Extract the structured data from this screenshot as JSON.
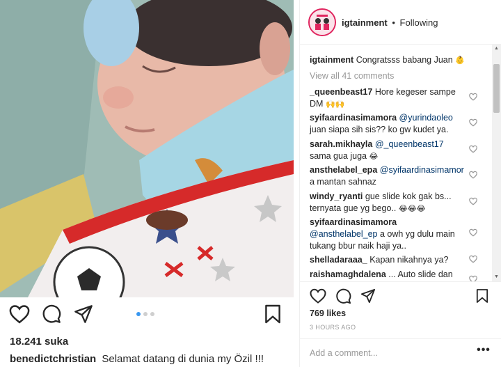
{
  "post": {
    "left_likes": "18.241 suka",
    "left_caption_user": "benedictchristian",
    "left_caption_text": "Selamat datang di dunia my Özil !!!",
    "carousel": {
      "count": 3,
      "active": 0
    }
  },
  "panel": {
    "header": {
      "username": "igtainment",
      "separator": "•",
      "follow_label": "Following"
    },
    "caption": {
      "user": "igtainment",
      "text": "Congratsss babang Juan",
      "emoji": "👶"
    },
    "view_all_label": "View all 41 comments",
    "comments": [
      {
        "user": "_queenbeast17",
        "text": "Hore kegeser sampe DM",
        "emoji": "🙌🙌"
      },
      {
        "user": "syifaardinasimamora",
        "mention": "@yurindaoleo",
        "text": "juan siapa sih sis?? ko gw kudet ya."
      },
      {
        "user": "sarah.mikhayla",
        "mention": "@_queenbeast17",
        "text": "sama gua juga",
        "emoji": "😂"
      },
      {
        "user": "ansthelabel_epa",
        "mention": "@syifaardinasimamor",
        "text": "a mantan sahnaz"
      },
      {
        "user": "windy_ryanti",
        "text": "gue slide kok gak bs... ternyata gue yg bego..",
        "emoji": "😂😂😂"
      },
      {
        "user": "syifaardinasimamora",
        "mention": "@ansthelabel_ep",
        "text": "a owh yg dulu main tukang bbur naik haji ya.."
      },
      {
        "user": "shelladaraaa_",
        "text": "Kapan nikahnya ya?"
      },
      {
        "user": "raishamaghdalena",
        "text": "... Auto slide dan"
      }
    ],
    "likes": "769 likes",
    "timestamp": "3 HOURS AGO",
    "add_comment_placeholder": "Add a comment...",
    "more_label": "•••"
  },
  "colors": {
    "mention": "#003569",
    "muted": "#999999",
    "carousel_active": "#3897f0",
    "avatar_ring": "#e0245e"
  }
}
